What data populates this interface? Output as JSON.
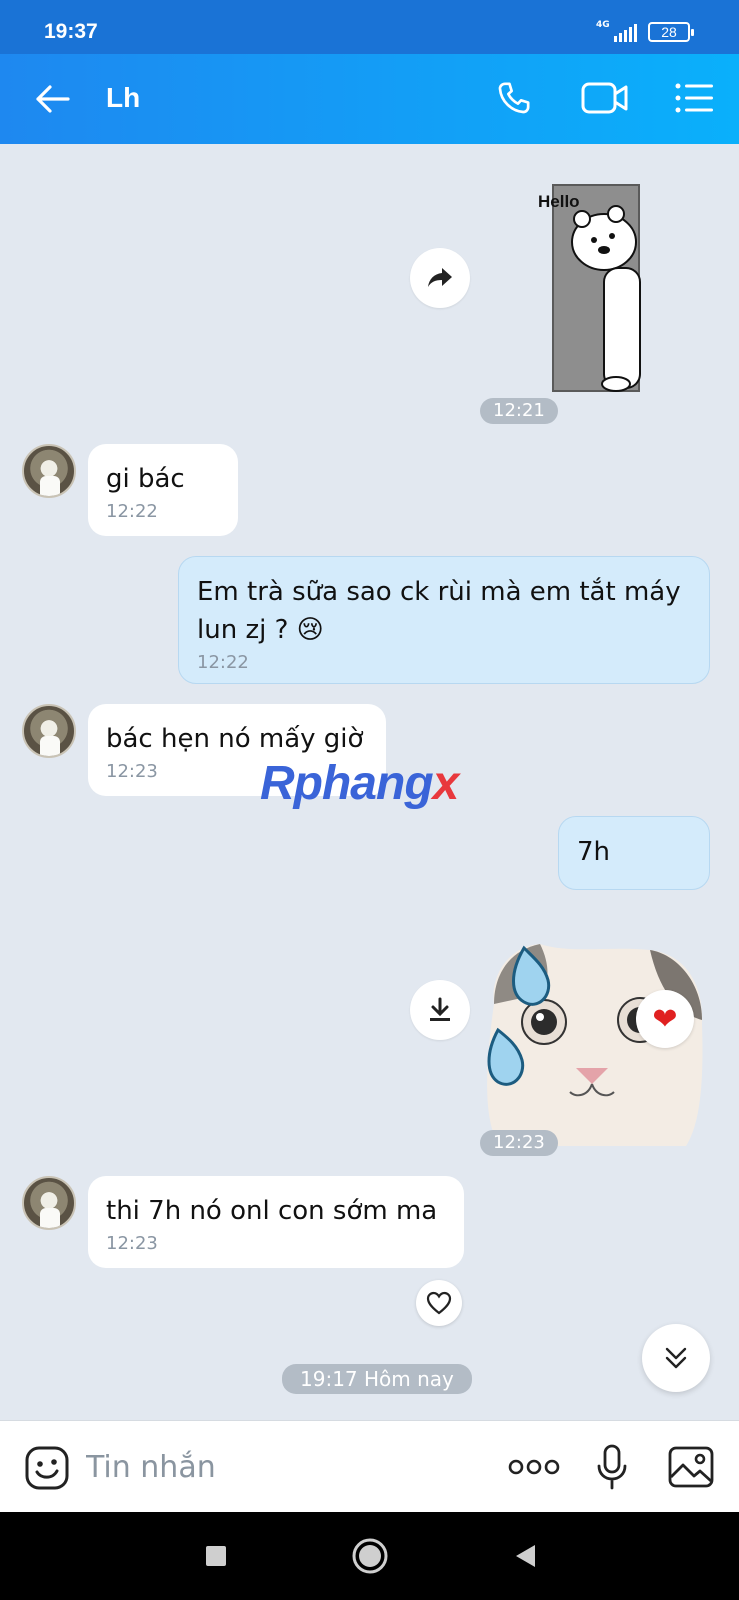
{
  "status_bar": {
    "time": "19:37",
    "network": "4G",
    "battery": "28"
  },
  "header": {
    "title": "Lh"
  },
  "messages": [
    {
      "id": "m1",
      "type": "sticker",
      "direction": "out",
      "sticker_text": "Hello",
      "time": "12:21"
    },
    {
      "id": "m2",
      "type": "text",
      "direction": "in",
      "text": "gi bác",
      "time": "12:22"
    },
    {
      "id": "m3",
      "type": "text",
      "direction": "out",
      "text_line1": "Em trà sữa sao ck rùi mà em tắt máy",
      "text_line2": "lun zj ? 😢",
      "time": "12:22"
    },
    {
      "id": "m4",
      "type": "text",
      "direction": "in",
      "text": "bác hẹn nó mấy giờ",
      "time": "12:23"
    },
    {
      "id": "m5",
      "type": "text",
      "direction": "out",
      "text": "7h"
    },
    {
      "id": "m6",
      "type": "sticker",
      "direction": "out",
      "reaction": "❤",
      "time": "12:23"
    },
    {
      "id": "m7",
      "type": "text",
      "direction": "in",
      "text": "thi 7h nó onl con sớm ma",
      "time": "12:23"
    }
  ],
  "day_divider": "19:17 Hôm nay",
  "watermark": {
    "part1": "Rphang",
    "part2": "x"
  },
  "input": {
    "placeholder": "Tin nhắn"
  },
  "colors": {
    "header_start": "#1e88f0",
    "header_end": "#0ab0fb",
    "bubble_out": "#d4ebfb",
    "bubble_in": "#ffffff",
    "chat_bg": "#e2e8f0"
  }
}
